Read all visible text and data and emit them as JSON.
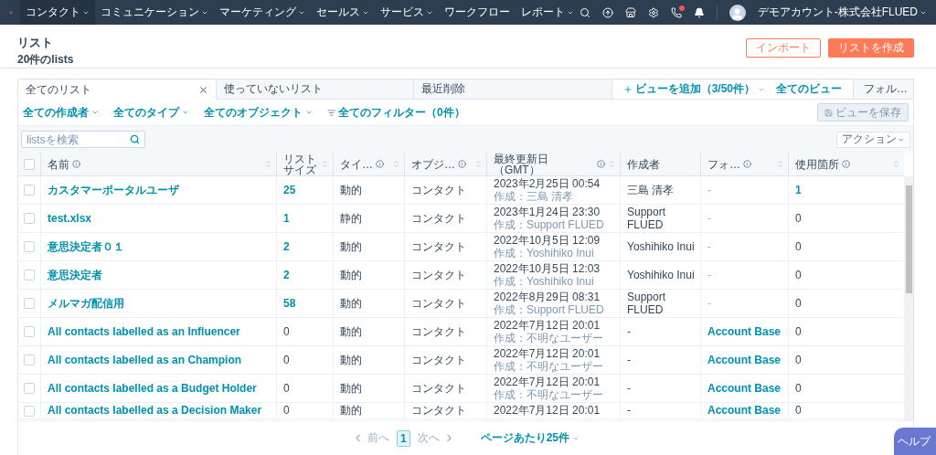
{
  "nav": {
    "items": [
      {
        "label": "コンタクト",
        "selected": true,
        "caret": true
      },
      {
        "label": "コミュニケーション",
        "selected": false,
        "caret": true
      },
      {
        "label": "マーケティング",
        "selected": false,
        "caret": true
      },
      {
        "label": "セールス",
        "selected": false,
        "caret": true
      },
      {
        "label": "サービス",
        "selected": false,
        "caret": true
      },
      {
        "label": "ワークフロー",
        "selected": false,
        "caret": false
      },
      {
        "label": "レポート",
        "selected": false,
        "caret": true
      }
    ],
    "icons": [
      {
        "kind": "search"
      },
      {
        "kind": "upgrade"
      },
      {
        "kind": "store"
      },
      {
        "kind": "settings"
      },
      {
        "kind": "phone"
      },
      {
        "kind": "bell"
      }
    ],
    "account": "デモアカウント-株式会社FLUED"
  },
  "header": {
    "title": "リスト",
    "subtitle": "20件のlists",
    "buttons": [
      {
        "label": "インポート",
        "kind": "secondary"
      },
      {
        "label": "リストを作成",
        "kind": "primary"
      }
    ]
  },
  "tabs": [
    {
      "label": "全てのリスト",
      "selected": true,
      "closable": true
    },
    {
      "label": "使っていないリスト",
      "selected": false,
      "closable": false
    },
    {
      "label": "最近削除",
      "selected": false,
      "closable": false
    }
  ],
  "view_links": {
    "add_view": "ビューを追加（3/50件）",
    "all_views": "全てのビュー",
    "folder_tab": "フォル…"
  },
  "filters": [
    {
      "label": "全ての作成者",
      "kind": "dropdown"
    },
    {
      "label": "全てのタイプ",
      "kind": "dropdown"
    },
    {
      "label": "全てのオブジェクト",
      "kind": "dropdown"
    },
    {
      "label": "全てのフィルター（0件）",
      "kind": "filter"
    }
  ],
  "save_view": "ビューを保存",
  "search": {
    "placeholder": "listsを検索"
  },
  "actions": "アクション",
  "table": {
    "select_all_checked": false,
    "columns": [
      {
        "label": "名前",
        "info": true,
        "sortable": true
      },
      {
        "label": "リストサイズ",
        "info": false,
        "sortable": true
      },
      {
        "label": "タイ…",
        "info": true,
        "sortable": true
      },
      {
        "label": "オブジ…",
        "info": true,
        "sortable": true
      },
      {
        "label": "最終更新日（GMT）",
        "info": true,
        "sortable": true
      },
      {
        "label": "作成者",
        "info": false,
        "sortable": false
      },
      {
        "label": "フォ…",
        "info": true,
        "sortable": true
      },
      {
        "label": "使用箇所",
        "info": true,
        "sortable": true
      }
    ],
    "rows": [
      {
        "checked": false,
        "name": "カスタマーポータルユーザ",
        "size": {
          "text": "25",
          "link": true
        },
        "type": "動的",
        "object": "コンタクト",
        "updated": "2023年2月25日 00:54",
        "created_by": "作成：三島 清孝",
        "author": "三島 清孝",
        "folder": {
          "text": "-",
          "link": false
        },
        "usage": {
          "text": "1",
          "link": true
        }
      },
      {
        "checked": false,
        "name": "test.xlsx",
        "size": {
          "text": "1",
          "link": true
        },
        "type": "静的",
        "object": "コンタクト",
        "updated": "2023年1月24日 23:30",
        "created_by": "作成：Support FLUED",
        "author": "Support FLUED",
        "folder": {
          "text": "-",
          "link": false
        },
        "usage": {
          "text": "0",
          "link": false
        }
      },
      {
        "checked": false,
        "name": "意思決定者０１",
        "size": {
          "text": "2",
          "link": true
        },
        "type": "動的",
        "object": "コンタクト",
        "updated": "2022年10月5日 12:09",
        "created_by": "作成：Yoshihiko Inui",
        "author": "Yoshihiko Inui",
        "folder": {
          "text": "-",
          "link": false
        },
        "usage": {
          "text": "0",
          "link": false
        }
      },
      {
        "checked": false,
        "name": "意思決定者",
        "size": {
          "text": "2",
          "link": true
        },
        "type": "動的",
        "object": "コンタクト",
        "updated": "2022年10月5日 12:03",
        "created_by": "作成：Yoshihiko Inui",
        "author": "Yoshihiko Inui",
        "folder": {
          "text": "-",
          "link": false
        },
        "usage": {
          "text": "0",
          "link": false
        }
      },
      {
        "checked": false,
        "name": "メルマガ配信用",
        "size": {
          "text": "58",
          "link": true
        },
        "type": "動的",
        "object": "コンタクト",
        "updated": "2022年8月29日 08:31",
        "created_by": "作成：Support FLUED",
        "author": "Support FLUED",
        "folder": {
          "text": "-",
          "link": false
        },
        "usage": {
          "text": "0",
          "link": false
        }
      },
      {
        "checked": false,
        "name": "All contacts labelled as an Influencer",
        "size": {
          "text": "0",
          "link": false
        },
        "type": "動的",
        "object": "コンタクト",
        "updated": "2022年7月12日 20:01",
        "created_by": "作成：不明なユーザー",
        "author": "-",
        "folder": {
          "text": "Account Base",
          "link": true
        },
        "usage": {
          "text": "0",
          "link": false
        }
      },
      {
        "checked": false,
        "name": "All contacts labelled as an Champion",
        "size": {
          "text": "0",
          "link": false
        },
        "type": "動的",
        "object": "コンタクト",
        "updated": "2022年7月12日 20:01",
        "created_by": "作成：不明なユーザー",
        "author": "-",
        "folder": {
          "text": "Account Base",
          "link": true
        },
        "usage": {
          "text": "0",
          "link": false
        }
      },
      {
        "checked": false,
        "name": "All contacts labelled as a Budget Holder",
        "size": {
          "text": "0",
          "link": false
        },
        "type": "動的",
        "object": "コンタクト",
        "updated": "2022年7月12日 20:01",
        "created_by": "作成：不明なユーザー",
        "author": "-",
        "folder": {
          "text": "Account Base",
          "link": true
        },
        "usage": {
          "text": "0",
          "link": false
        }
      },
      {
        "checked": false,
        "name": "All contacts labelled as a Decision Maker",
        "size": {
          "text": "0",
          "link": false
        },
        "type": "動的",
        "object": "コンタクト",
        "updated": "2022年7月12日 20:01",
        "author": "-",
        "folder": {
          "text": "Account Base",
          "link": true
        },
        "usage": {
          "text": "0",
          "link": false
        }
      }
    ]
  },
  "pagination": {
    "prev": "前へ",
    "page": "1",
    "next": "次へ",
    "per_page": "ページあたり25件"
  },
  "help": "ヘルプ"
}
